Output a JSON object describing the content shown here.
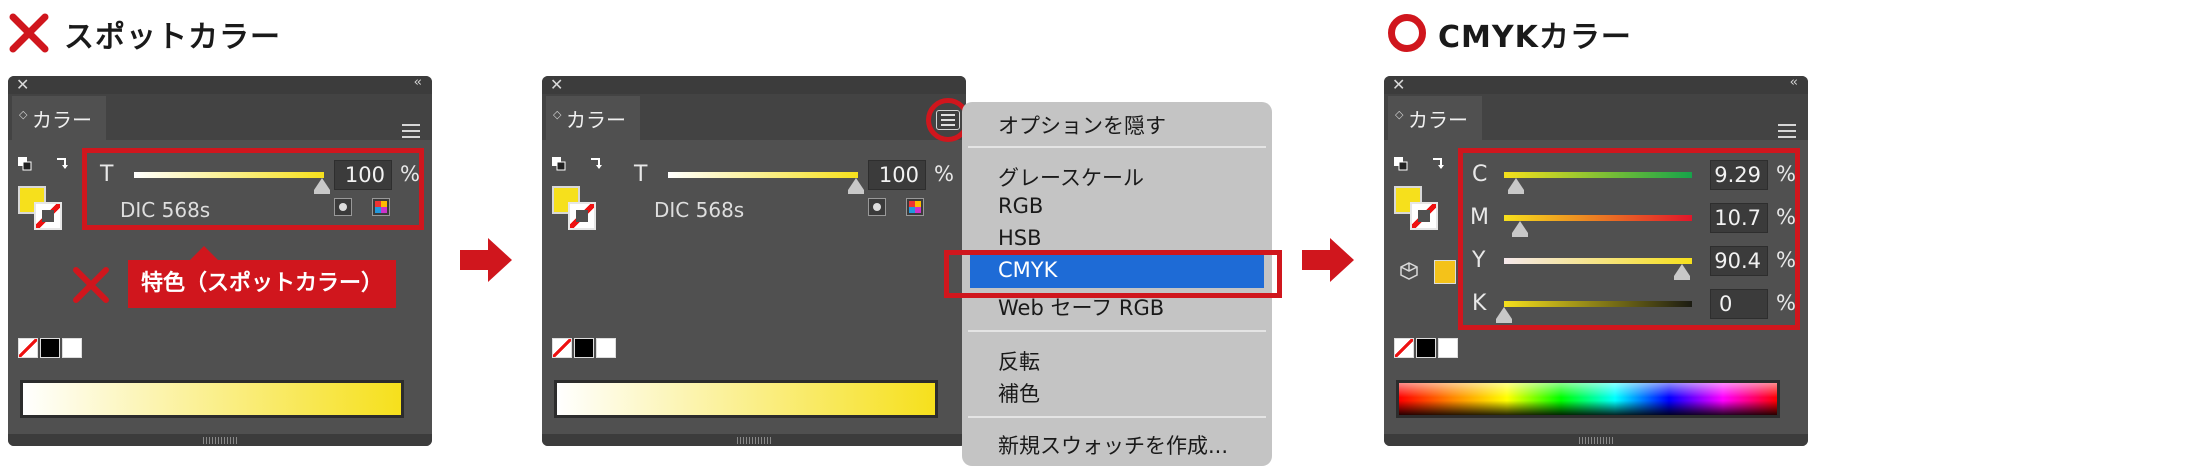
{
  "headings": {
    "left": "スポットカラー",
    "right": "CMYKカラー"
  },
  "panel": {
    "tab_label": "カラー"
  },
  "spot": {
    "tint_label": "T",
    "tint_value": "100",
    "percent": "%",
    "swatch_name": "DIC 568s",
    "tint_fraction": 1.0
  },
  "callout": {
    "text": "特色（スポットカラー）"
  },
  "menu": {
    "items": [
      {
        "label": "オプションを隠す"
      },
      {
        "label": "グレースケール"
      },
      {
        "label": "RGB"
      },
      {
        "label": "HSB"
      },
      {
        "label": "CMYK",
        "selected": true
      },
      {
        "label": "Web セーフ RGB"
      },
      {
        "label": "反転"
      },
      {
        "label": "補色"
      },
      {
        "label": "新規スウォッチを作成..."
      }
    ]
  },
  "cmyk": {
    "channels": [
      {
        "label": "C",
        "value": "9.29"
      },
      {
        "label": "M",
        "value": "10.7"
      },
      {
        "label": "Y",
        "value": "90.4"
      },
      {
        "label": "K",
        "value": "0"
      }
    ],
    "percent": "%"
  },
  "colors": {
    "accent_red": "#d0161d",
    "spot_yellow": "#f6e01c",
    "panel_bg": "#505050",
    "menu_highlight": "#1e6bd6"
  }
}
